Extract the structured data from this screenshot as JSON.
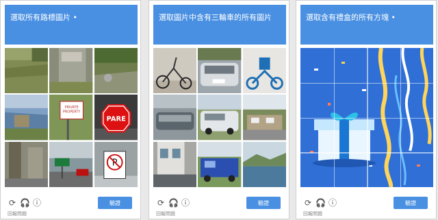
{
  "panels": [
    {
      "instruction": "選取所有路標圖片 •",
      "tiles": [
        {
          "label": ""
        },
        {
          "label": ""
        },
        {
          "label": ""
        },
        {
          "label": "PRIVATE\nPROPERTY"
        },
        {
          "label": ""
        },
        {
          "label": "PARE"
        },
        {
          "label": ""
        },
        {
          "label": ""
        },
        {
          "label": "P"
        }
      ],
      "verify_label": "驗證",
      "report_label": "回報問題"
    },
    {
      "instruction": "選取圖片中含有三輪車的所有圖片",
      "tiles": [
        {
          "label": ""
        },
        {
          "label": ""
        },
        {
          "label": ""
        },
        {
          "label": ""
        },
        {
          "label": ""
        },
        {
          "label": ""
        },
        {
          "label": ""
        },
        {
          "label": ""
        },
        {
          "label": ""
        }
      ],
      "verify_label": "驗證",
      "report_label": "回報問題"
    },
    {
      "instruction": "選取含有禮盒的所有方塊 •",
      "verify_label": "驗證",
      "report_label": "回報問題"
    }
  ],
  "icons": {
    "reload": "reload-icon",
    "audio": "headphones-icon",
    "info": "info-icon"
  },
  "colors": {
    "accent": "#4a90e2",
    "gift_bg": "#2f6fd6"
  }
}
